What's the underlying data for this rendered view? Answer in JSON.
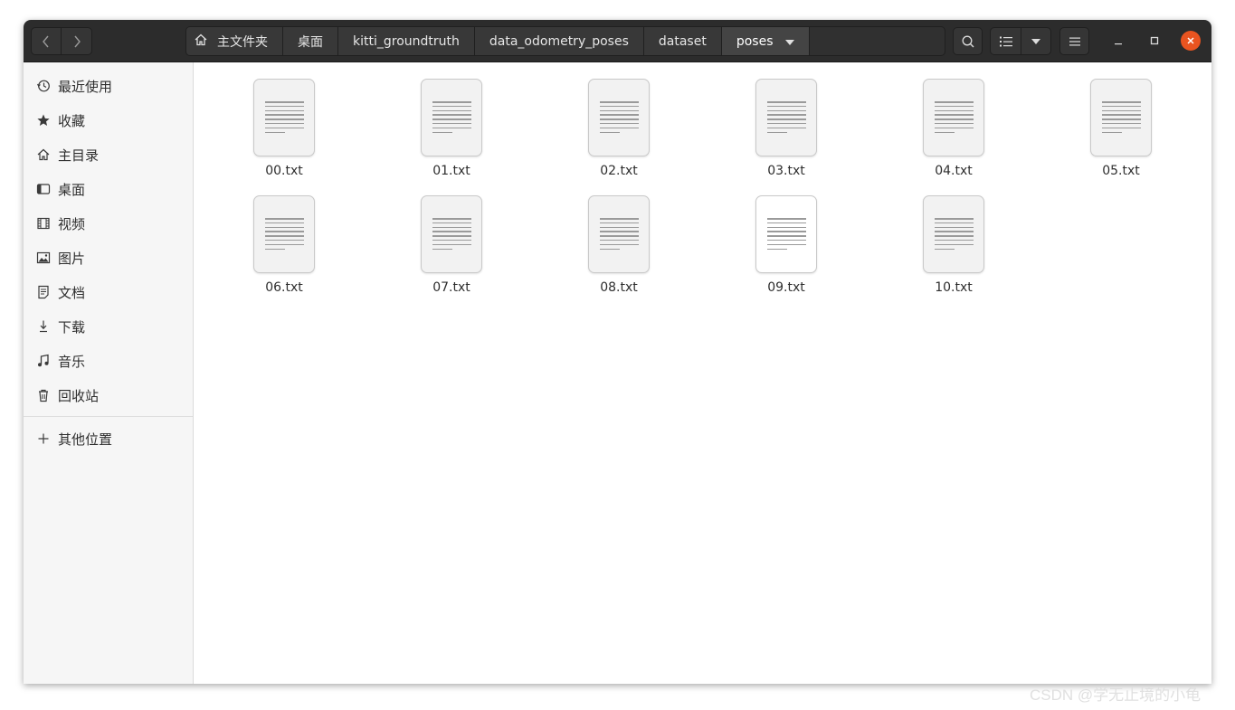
{
  "nav": {
    "back_icon": "chevron-left-icon",
    "forward_icon": "chevron-right-icon"
  },
  "pathbar": {
    "crumbs": [
      {
        "label": "主文件夹",
        "icon": "home-icon"
      },
      {
        "label": "桌面"
      },
      {
        "label": "kitti_groundtruth"
      },
      {
        "label": "data_odometry_poses"
      },
      {
        "label": "dataset"
      },
      {
        "label": "poses"
      }
    ]
  },
  "sidebar": {
    "items": [
      {
        "label": "最近使用",
        "icon": "recent-icon"
      },
      {
        "label": "收藏",
        "icon": "star-icon"
      },
      {
        "label": "主目录",
        "icon": "home-icon"
      },
      {
        "label": "桌面",
        "icon": "desktop-icon"
      },
      {
        "label": "视频",
        "icon": "video-icon"
      },
      {
        "label": "图片",
        "icon": "picture-icon"
      },
      {
        "label": "文档",
        "icon": "document-icon"
      },
      {
        "label": "下载",
        "icon": "download-icon"
      },
      {
        "label": "音乐",
        "icon": "music-icon"
      },
      {
        "label": "回收站",
        "icon": "trash-icon"
      }
    ],
    "other_locations": {
      "label": "其他位置",
      "icon": "plus-icon"
    }
  },
  "files": [
    {
      "name": "00.txt"
    },
    {
      "name": "01.txt"
    },
    {
      "name": "02.txt"
    },
    {
      "name": "03.txt"
    },
    {
      "name": "04.txt"
    },
    {
      "name": "05.txt"
    },
    {
      "name": "06.txt"
    },
    {
      "name": "07.txt"
    },
    {
      "name": "08.txt"
    },
    {
      "name": "09.txt"
    },
    {
      "name": "10.txt"
    }
  ],
  "watermark": "CSDN @学无止境的小龟",
  "colors": {
    "headerbar": "#2c2c2c",
    "close_button": "#e95420",
    "sidebar_bg": "#f6f6f6"
  }
}
